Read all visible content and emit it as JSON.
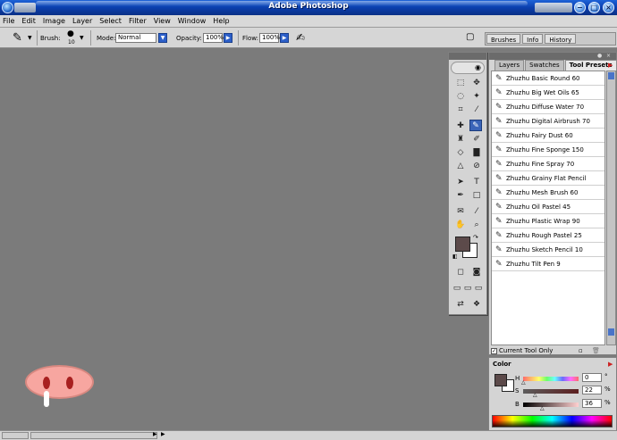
{
  "window": {
    "title": "Adobe Photoshop"
  },
  "menu": [
    "File",
    "Edit",
    "Image",
    "Layer",
    "Select",
    "Filter",
    "View",
    "Window",
    "Help"
  ],
  "options_bar": {
    "brush_label": "Brush:",
    "brush_size": "10",
    "mode_label": "Mode:",
    "mode_value": "Normal",
    "opacity_label": "Opacity:",
    "opacity_value": "100%",
    "flow_label": "Flow:",
    "flow_value": "100%"
  },
  "palette_well_tabs": [
    "Brushes",
    "Info",
    "History"
  ],
  "presets_panel": {
    "tabs": [
      "Layers",
      "Swatches",
      "Tool Presets"
    ],
    "active_tab": "Tool Presets",
    "items": [
      "Zhuzhu Basic Round 60",
      "Zhuzhu Big Wet Oils 65",
      "Zhuzhu Diffuse Water 70",
      "Zhuzhu Digital Airbrush 70",
      "Zhuzhu Fairy Dust 60",
      "Zhuzhu Fine Sponge 150",
      "Zhuzhu Fine Spray 70",
      "Zhuzhu Grainy Flat Pencil",
      "Zhuzhu Mesh Brush 60",
      "Zhuzhu Oil Pastel 45",
      "Zhuzhu Plastic Wrap 90",
      "Zhuzhu Rough Pastel 25",
      "Zhuzhu Sketch Pencil 10",
      "Zhuzhu Tilt Pen 9"
    ],
    "current_tool_only": "Current Tool Only"
  },
  "color_panel": {
    "tab": "Color",
    "h_label": "H",
    "h_value": "0",
    "h_unit": "°",
    "s_label": "S",
    "s_value": "22",
    "s_unit": "%",
    "b_label": "B",
    "b_value": "36",
    "b_unit": "%",
    "foreground": "#5c4a4a",
    "background": "#ffffff"
  },
  "toolbox": {
    "foreground": "#5c4a4a",
    "background": "#ffffff"
  }
}
